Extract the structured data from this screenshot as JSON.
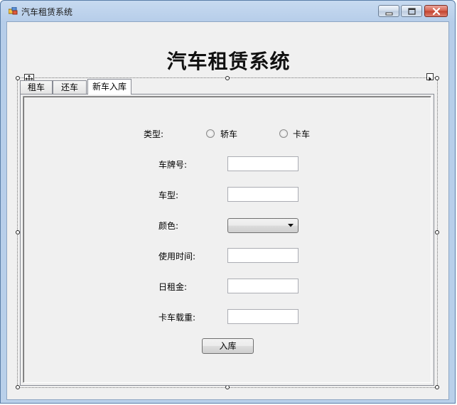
{
  "window": {
    "title": "汽车租赁系统"
  },
  "heading": "汽车租赁系统",
  "tabs": [
    {
      "label": "租车",
      "active": false
    },
    {
      "label": "还车",
      "active": false
    },
    {
      "label": "新车入库",
      "active": true
    }
  ],
  "form": {
    "type_label": "类型:",
    "type_options": [
      "轿车",
      "卡车"
    ],
    "plate_label": "车牌号:",
    "model_label": "车型:",
    "color_label": "颜色:",
    "usage_label": "使用时间:",
    "rent_label": "日租金:",
    "load_label": "卡车载重:",
    "plate_value": "",
    "model_value": "",
    "color_value": "",
    "usage_value": "",
    "rent_value": "",
    "load_value": "",
    "submit_label": "入库"
  },
  "icons": {
    "app": "app-icon",
    "minimize": "minimize-icon",
    "maximize": "maximize-icon",
    "close": "close-icon",
    "move": "move-handle-icon",
    "smart_tag": "smart-tag-icon",
    "dropdown": "chevron-down-icon"
  },
  "colors": {
    "close_button": "#c2402c",
    "title_bar": "#c7daf0",
    "client_bg": "#f0f0f0"
  }
}
